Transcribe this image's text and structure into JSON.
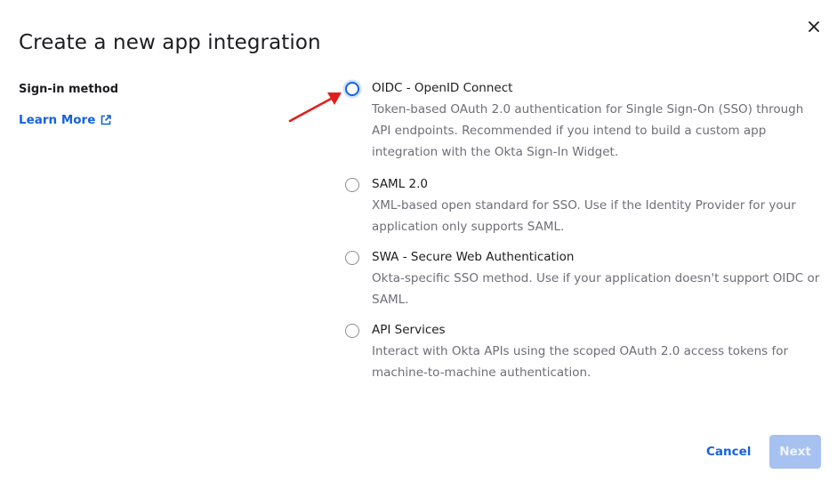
{
  "dialog": {
    "title": "Create a new app integration",
    "close_icon": "close-icon"
  },
  "sidebar": {
    "section_label": "Sign-in method",
    "learn_more_label": "Learn More",
    "learn_more_icon": "external-link-icon"
  },
  "options": [
    {
      "title": "OIDC - OpenID Connect",
      "description": "Token-based OAuth 2.0 authentication for Single Sign-On (SSO) through API endpoints. Recommended if you intend to build a custom app integration with the Okta Sign-In Widget.",
      "selected": true
    },
    {
      "title": "SAML 2.0",
      "description": "XML-based open standard for SSO. Use if the Identity Provider for your application only supports SAML.",
      "selected": false
    },
    {
      "title": "SWA - Secure Web Authentication",
      "description": "Okta-specific SSO method. Use if your application doesn't support OIDC or SAML.",
      "selected": false
    },
    {
      "title": "API Services",
      "description": "Interact with Okta APIs using the scoped OAuth 2.0 access tokens for machine-to-machine authentication.",
      "selected": false
    }
  ],
  "footer": {
    "cancel_label": "Cancel",
    "next_label": "Next",
    "next_enabled": false
  },
  "colors": {
    "accent": "#1662dd",
    "disabled_button": "#a7c2f0",
    "annotation_arrow": "#e02020",
    "muted_text": "#6e6e78"
  }
}
